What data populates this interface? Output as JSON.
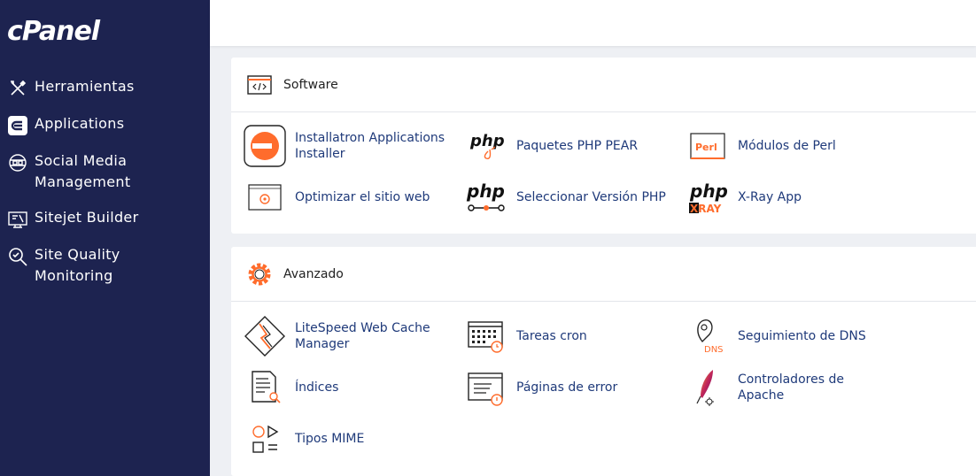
{
  "sidebar": {
    "logo": "cPanel",
    "items": [
      {
        "label": "Herramientas",
        "icon": "tools-icon"
      },
      {
        "label": "Applications",
        "icon": "applications-icon"
      },
      {
        "label": "Social Media Management",
        "icon": "social-media-icon"
      },
      {
        "label": "Sitejet Builder",
        "icon": "sitejet-icon"
      },
      {
        "label": "Site Quality Monitoring",
        "icon": "site-quality-icon"
      }
    ]
  },
  "software": {
    "title": "Software",
    "items": [
      {
        "label": "Installatron Applications Installer",
        "icon": "installatron-icon"
      },
      {
        "label": "Paquetes PHP PEAR",
        "icon": "php-pear-icon"
      },
      {
        "label": "Módulos de Perl",
        "icon": "perl-icon"
      },
      {
        "label": "Optimizar el sitio web",
        "icon": "optimize-website-icon"
      },
      {
        "label": "Seleccionar Versión PHP",
        "icon": "php-version-icon"
      },
      {
        "label": "X-Ray App",
        "icon": "xray-icon"
      }
    ],
    "icon_text": {
      "php": "php",
      "perl": "Perl",
      "xray": "XRAY"
    }
  },
  "avanzado": {
    "title": "Avanzado",
    "items": [
      {
        "label": "LiteSpeed Web Cache Manager",
        "icon": "litespeed-icon"
      },
      {
        "label": "Tareas cron",
        "icon": "cron-icon"
      },
      {
        "label": "Seguimiento de DNS",
        "icon": "dns-tracking-icon"
      },
      {
        "label": "Índices",
        "icon": "indexes-icon"
      },
      {
        "label": "Páginas de error",
        "icon": "error-pages-icon"
      },
      {
        "label": "Controladores de Apache",
        "icon": "apache-handlers-icon"
      },
      {
        "label": "Tipos MIME",
        "icon": "mime-types-icon"
      }
    ],
    "icon_text": {
      "dns": "DNS"
    }
  },
  "colors": {
    "sidebar": "#1d2350",
    "accent": "#ff6c2c",
    "link": "#1f3a7a"
  }
}
